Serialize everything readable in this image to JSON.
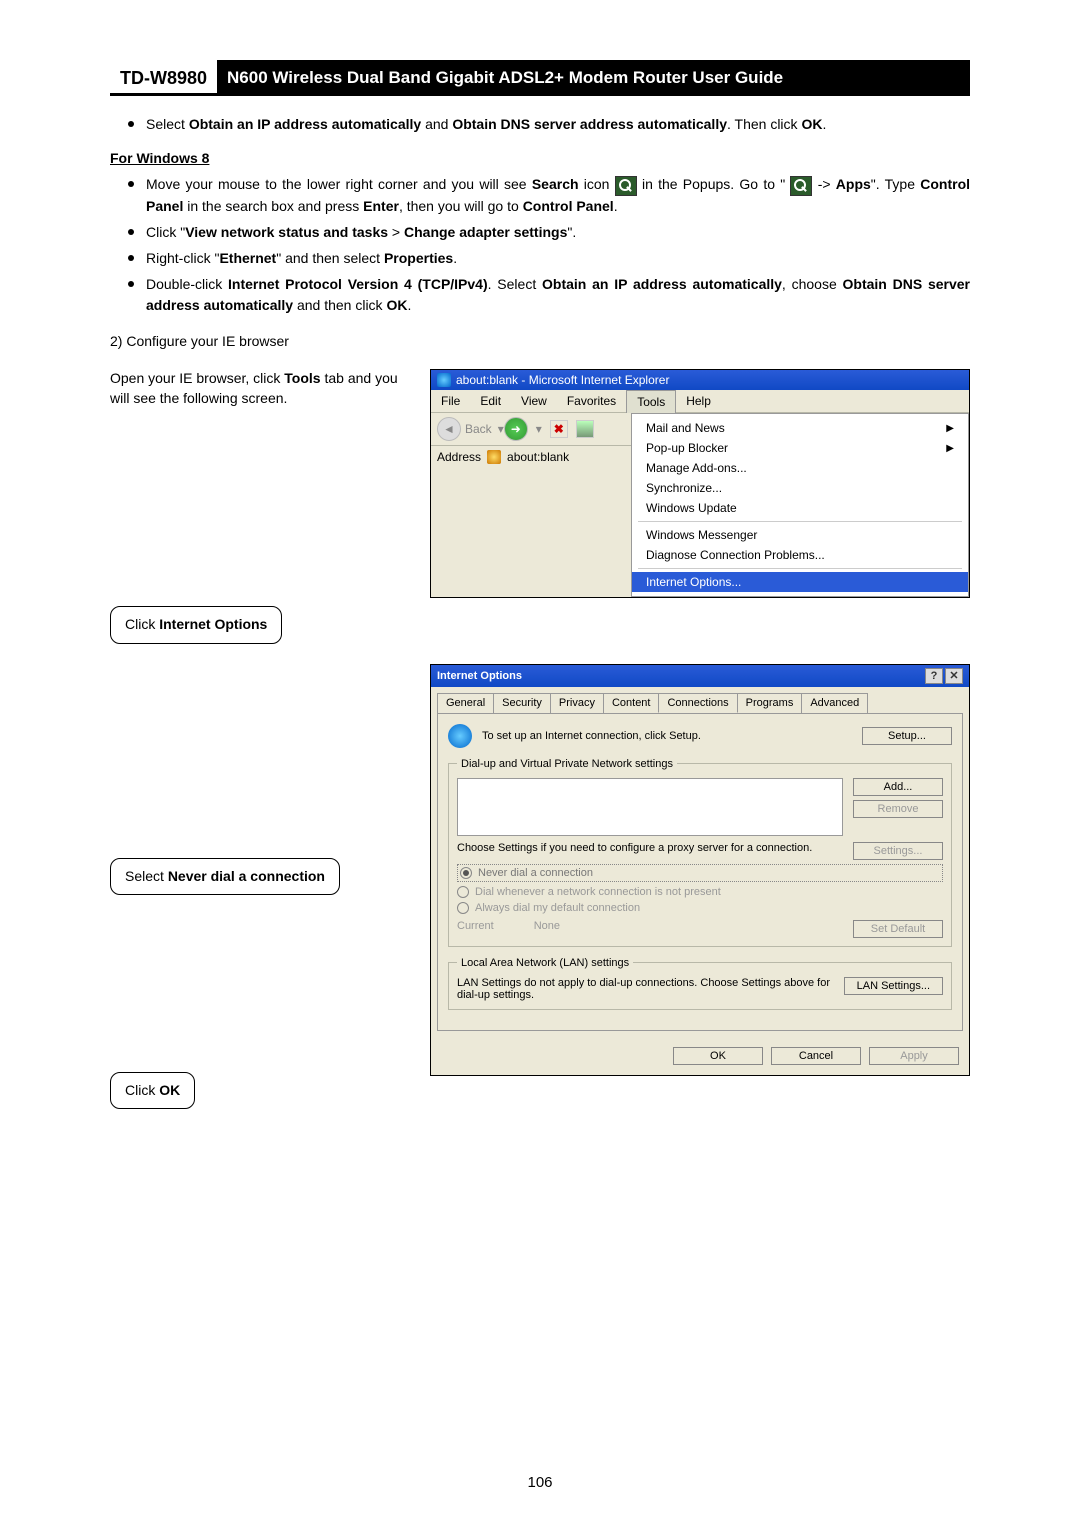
{
  "header": {
    "model": "TD-W8980",
    "title": "N600 Wireless Dual Band Gigabit ADSL2+ Modem Router User Guide"
  },
  "bullets_top": [
    {
      "html": "Select <b>Obtain an IP address automatically</b> and <b>Obtain DNS server address automatically</b>. Then click <b>OK</b>."
    }
  ],
  "win8_head": "For Windows 8",
  "win8_bullets": [
    {
      "html": "Move your mouse to the lower right corner and you will see <b>Search</b> icon <span class='search-icon' data-name='search-icon' data-interactable='false'></span> in the Popups. Go to \" <span class='search-icon' data-name='search-icon' data-interactable='false'></span> -> <b>Apps</b>\". Type <b>Control Panel</b> in the search box and press <b>Enter</b>, then you will go to <b>Control Panel</b>."
    },
    {
      "html": "Click \"<b>View network status and tasks</b> > <b>Change adapter settings</b>\"."
    },
    {
      "html": "Right-click \"<b>Ethernet</b>\" and then select <b>Properties</b>."
    },
    {
      "html": "Double-click <b>Internet Protocol Version 4 (TCP/IPv4)</b>. Select <b>Obtain an IP address automatically</b>, choose <b>Obtain DNS server address automatically</b> and then click <b>OK</b>."
    }
  ],
  "step2": "2)  Configure your IE browser",
  "instr1": {
    "html": "Open your IE browser, click <b>Tools</b> tab and you will see the following screen."
  },
  "instr2": {
    "html": "Click <b>Internet Options</b>"
  },
  "instr3": {
    "html": "Select <b>Never dial a connection</b>"
  },
  "instr4": {
    "html": "Click <b>OK</b>"
  },
  "ie": {
    "title": "about:blank - Microsoft Internet Explorer",
    "menu": [
      "File",
      "Edit",
      "View",
      "Favorites",
      "Tools",
      "Help"
    ],
    "back": "Back",
    "address_label": "Address",
    "address_value": "about:blank",
    "drop": [
      "Mail and News",
      "Pop-up Blocker",
      "Manage Add-ons...",
      "Synchronize...",
      "Windows Update",
      "---",
      "Windows Messenger",
      "Diagnose Connection Problems...",
      "---hl",
      "Internet Options..."
    ]
  },
  "iod": {
    "title": "Internet Options",
    "tabs": [
      "General",
      "Security",
      "Privacy",
      "Content",
      "Connections",
      "Programs",
      "Advanced"
    ],
    "setup_text": "To set up an Internet connection, click Setup.",
    "btn_setup": "Setup...",
    "fs1": "Dial-up and Virtual Private Network settings",
    "btn_add": "Add...",
    "btn_remove": "Remove",
    "proxy_text": "Choose Settings if you need to configure a proxy server for a connection.",
    "btn_settings": "Settings...",
    "r1": "Never dial a connection",
    "r2": "Dial whenever a network connection is not present",
    "r3": "Always dial my default connection",
    "current": "Current",
    "none": "None",
    "btn_setdefault": "Set Default",
    "fs2": "Local Area Network (LAN) settings",
    "lan_text": "LAN Settings do not apply to dial-up connections. Choose Settings above for dial-up settings.",
    "btn_lan": "LAN Settings...",
    "btn_ok": "OK",
    "btn_cancel": "Cancel",
    "btn_apply": "Apply"
  },
  "page_number": "106"
}
